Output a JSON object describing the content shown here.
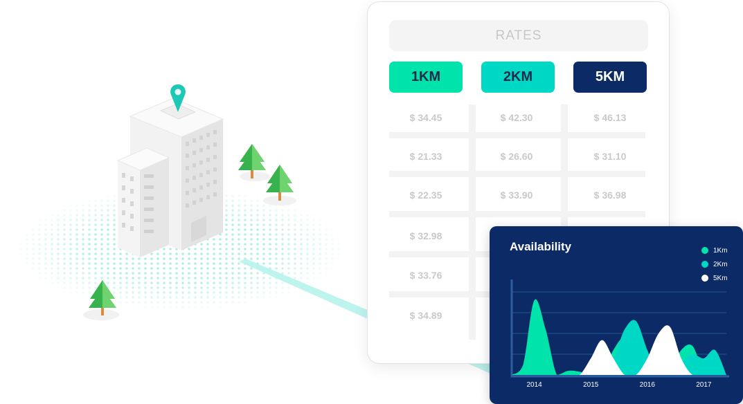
{
  "rates": {
    "header": "RATES",
    "tabs": [
      "1KM",
      "2KM",
      "5KM"
    ],
    "rows": [
      [
        "$ 34.45",
        "$ 42.30",
        "$ 46.13"
      ],
      [
        "$ 21.33",
        "$ 26.60",
        "$ 31.10"
      ],
      [
        "$ 22.35",
        "$ 33.90",
        "$ 36.98"
      ],
      [
        "$ 32.98",
        "",
        ""
      ],
      [
        "$ 33.76",
        "",
        ""
      ],
      [
        "$ 34.89",
        "",
        ""
      ]
    ]
  },
  "availability": {
    "title": "Availability",
    "legend": [
      {
        "label": "1Km",
        "color": "#00e3ab"
      },
      {
        "label": "2Km",
        "color": "#00d8c6"
      },
      {
        "label": "5Km",
        "color": "#ffffff"
      }
    ]
  },
  "chart_data": {
    "type": "area",
    "title": "Availability",
    "x_ticks": [
      "2014",
      "2015",
      "2016",
      "2017"
    ],
    "x": [
      2013.6,
      2013.8,
      2014.0,
      2014.2,
      2014.4,
      2014.6,
      2014.8,
      2015.0,
      2015.2,
      2015.4,
      2015.6,
      2015.8,
      2016.0,
      2016.2,
      2016.4,
      2016.6,
      2016.8,
      2017.0,
      2017.2,
      2017.4
    ],
    "ylim": [
      0,
      100
    ],
    "series": [
      {
        "name": "1Km",
        "color": "#00e3ab",
        "values": [
          0,
          12,
          90,
          55,
          0,
          5,
          4,
          0,
          0,
          30,
          45,
          25,
          0,
          0,
          5,
          30,
          35,
          5,
          15,
          0
        ]
      },
      {
        "name": "2Km",
        "color": "#00d8c6",
        "values": [
          0,
          0,
          0,
          0,
          0,
          0,
          0,
          0,
          5,
          20,
          55,
          65,
          30,
          0,
          0,
          15,
          25,
          20,
          30,
          0
        ]
      },
      {
        "name": "5Km",
        "color": "#ffffff",
        "values": [
          0,
          0,
          0,
          0,
          0,
          0,
          0,
          20,
          42,
          20,
          0,
          0,
          20,
          50,
          58,
          20,
          0,
          0,
          0,
          0
        ]
      }
    ],
    "grid": true,
    "legend_position": "top-right"
  }
}
